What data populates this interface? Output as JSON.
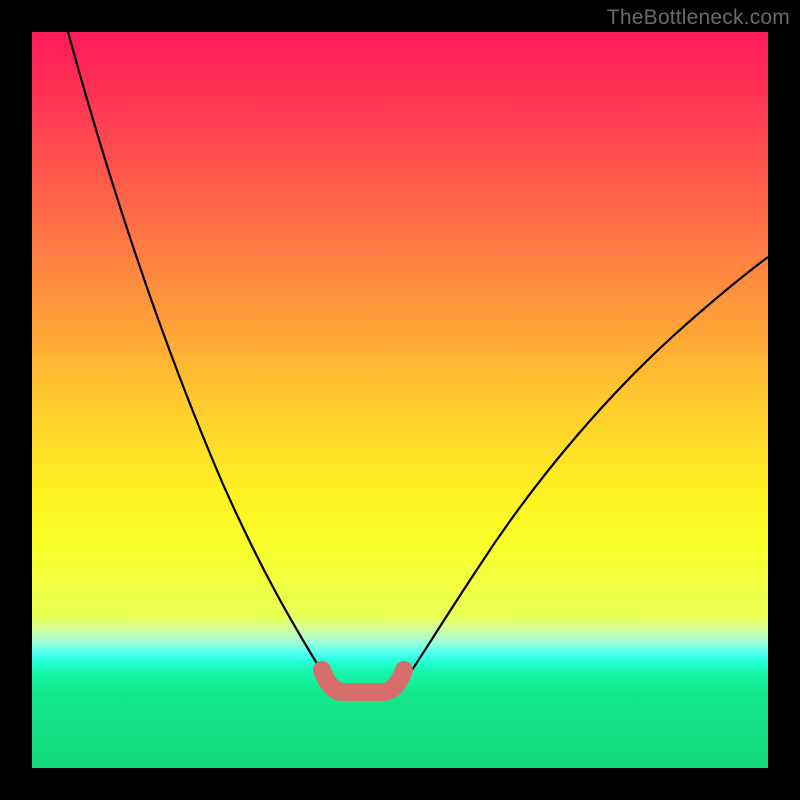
{
  "watermark": "TheBottleneck.com",
  "colors": {
    "frame": "#000000",
    "curve_stroke": "#000000",
    "hump_stroke": "#d66e6e",
    "watermark_text": "#6a6a6a",
    "gradient_top": "#ff1a5a",
    "gradient_bottom": "#14db7c"
  },
  "chart_data": {
    "type": "line",
    "title": "",
    "xlabel": "",
    "ylabel": "",
    "xlim": [
      0,
      100
    ],
    "ylim": [
      0,
      100
    ],
    "series": [
      {
        "name": "left-curve",
        "x": [
          5,
          10,
          15,
          20,
          25,
          30,
          33,
          36,
          38,
          40
        ],
        "values": [
          100,
          84,
          67,
          51,
          36,
          22,
          13,
          7,
          3,
          0
        ]
      },
      {
        "name": "right-curve",
        "x": [
          50,
          52,
          55,
          60,
          65,
          70,
          75,
          80,
          85,
          90,
          95,
          100
        ],
        "values": [
          0,
          2,
          6,
          14,
          22,
          30,
          37,
          44,
          50,
          56,
          61,
          66
        ]
      },
      {
        "name": "flat-bottom-hump",
        "x": [
          40,
          42,
          48,
          50
        ],
        "values": [
          3,
          0,
          0,
          3
        ]
      }
    ],
    "annotations": [
      {
        "text": "TheBottleneck.com",
        "position": "top-right"
      }
    ]
  }
}
